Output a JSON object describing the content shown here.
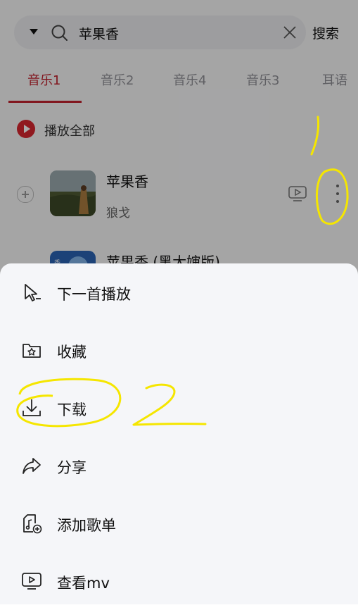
{
  "search": {
    "query": "苹果香",
    "button_label": "搜索"
  },
  "tabs": [
    {
      "label": "音乐1",
      "active": true
    },
    {
      "label": "音乐2",
      "active": false
    },
    {
      "label": "音乐4",
      "active": false
    },
    {
      "label": "音乐3",
      "active": false
    },
    {
      "label": "耳语",
      "active": false
    }
  ],
  "play_all_label": "播放全部",
  "songs": [
    {
      "title": "苹果香",
      "artist": "狼戈"
    },
    {
      "title": "苹果香 (黑大婶版)"
    }
  ],
  "menu": {
    "items": [
      {
        "label": "下一首播放",
        "icon": "play-next-icon"
      },
      {
        "label": "收藏",
        "icon": "favorite-folder-icon"
      },
      {
        "label": "下载",
        "icon": "download-icon"
      },
      {
        "label": "分享",
        "icon": "share-icon"
      },
      {
        "label": "添加歌单",
        "icon": "add-to-playlist-icon"
      },
      {
        "label": "查看mv",
        "icon": "mv-icon"
      }
    ]
  },
  "colors": {
    "accent": "#c0222d",
    "annotation": "#f5e600"
  }
}
